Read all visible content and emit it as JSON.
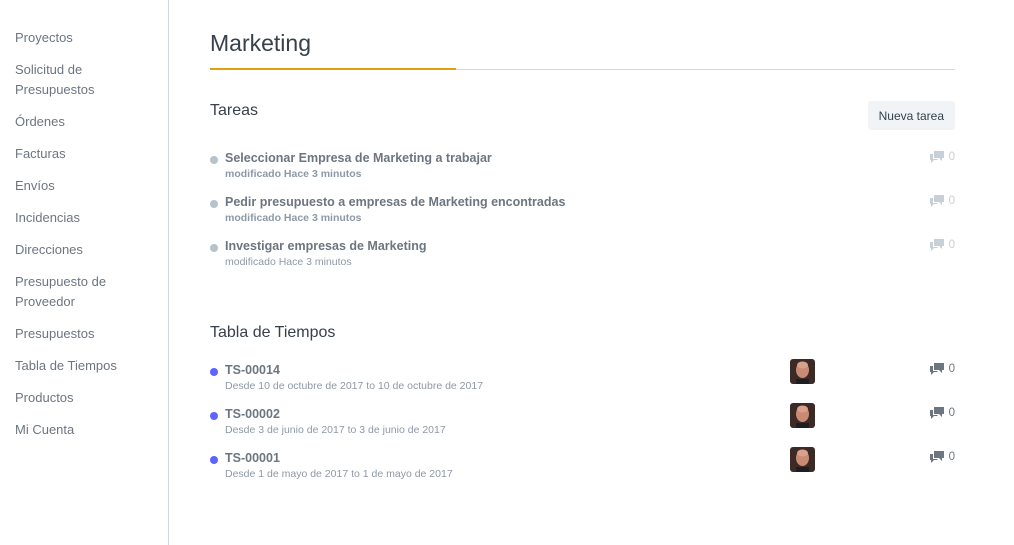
{
  "sidebar": {
    "items": [
      {
        "label": "Proyectos"
      },
      {
        "label": "Solicitud de Presupuestos"
      },
      {
        "label": "Órdenes"
      },
      {
        "label": "Facturas"
      },
      {
        "label": "Envíos"
      },
      {
        "label": "Incidencias"
      },
      {
        "label": "Direcciones"
      },
      {
        "label": "Presupuesto de Proveedor"
      },
      {
        "label": "Presupuestos"
      },
      {
        "label": "Tabla de Tiempos"
      },
      {
        "label": "Productos"
      },
      {
        "label": "Mi Cuenta"
      }
    ]
  },
  "page": {
    "title": "Marketing"
  },
  "tasks": {
    "title": "Tareas",
    "new_button": "Nueva tarea",
    "items": [
      {
        "title": "Seleccionar Empresa de Marketing a trabajar",
        "subtitle": "modificado Hace 3 minutos",
        "comments": "0"
      },
      {
        "title": "Pedir presupuesto a empresas de Marketing encontradas",
        "subtitle": "modificado Hace 3 minutos",
        "comments": "0"
      },
      {
        "title": "Investigar empresas de Marketing",
        "subtitle": "modificado Hace 3 minutos",
        "comments": "0"
      }
    ]
  },
  "timesheets": {
    "title": "Tabla de Tiempos",
    "items": [
      {
        "title": "TS-00014",
        "subtitle": "Desde 10 de octubre de 2017 to 10 de octubre de 2017",
        "comments": "0"
      },
      {
        "title": "TS-00002",
        "subtitle": "Desde 3 de junio de 2017 to 3 de junio de 2017",
        "comments": "0"
      },
      {
        "title": "TS-00001",
        "subtitle": "Desde 1 de mayo de 2017 to 1 de mayo de 2017",
        "comments": "0"
      }
    ]
  },
  "colors": {
    "accent": "#e39e11",
    "status_grey": "#b8c2cc",
    "status_blue": "#5e64ff"
  },
  "icons": {
    "comment": "comments-icon",
    "avatar": "user-avatar"
  }
}
